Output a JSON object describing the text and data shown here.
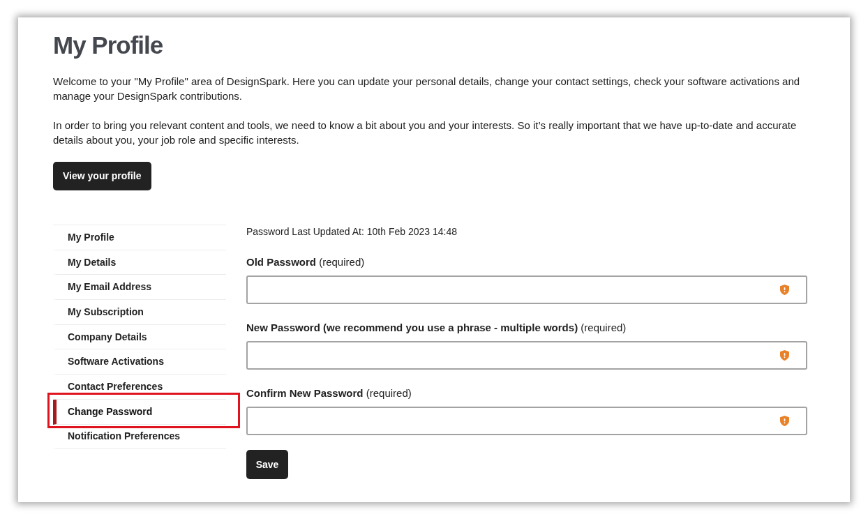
{
  "page": {
    "title": "My Profile",
    "intro": [
      "Welcome to your \"My Profile\" area of DesignSpark. Here you can update your personal details, change your contact settings, check your software activations and manage your DesignSpark contributions.",
      "In order to bring you relevant content and tools, we need to know a bit about you and your interests. So it’s really important that we have up-to-date and accurate details about you, your job role and specific interests."
    ],
    "profile_button": "View your profile"
  },
  "sidebar": {
    "items": [
      {
        "label": "My Profile",
        "selected": false,
        "highlighted": false
      },
      {
        "label": "My Details",
        "selected": false,
        "highlighted": false
      },
      {
        "label": "My Email Address",
        "selected": false,
        "highlighted": false
      },
      {
        "label": "My Subscription",
        "selected": false,
        "highlighted": false
      },
      {
        "label": "Company Details",
        "selected": false,
        "highlighted": false
      },
      {
        "label": "Software Activations",
        "selected": false,
        "highlighted": false
      },
      {
        "label": "Contact Preferences",
        "selected": false,
        "highlighted": false
      },
      {
        "label": "Change Password",
        "selected": true,
        "highlighted": true
      },
      {
        "label": "Notification Preferences",
        "selected": false,
        "highlighted": false
      }
    ]
  },
  "form": {
    "last_updated": "Password Last Updated At: 10th Feb 2023 14:48",
    "fields": [
      {
        "label": "**Old Password** (required)"
      },
      {
        "label": "**New Password (we recommend you use a phrase - multiple words)** (required)"
      },
      {
        "label": "**Confirm New Password** (required)"
      }
    ],
    "save_button": "Save"
  }
}
